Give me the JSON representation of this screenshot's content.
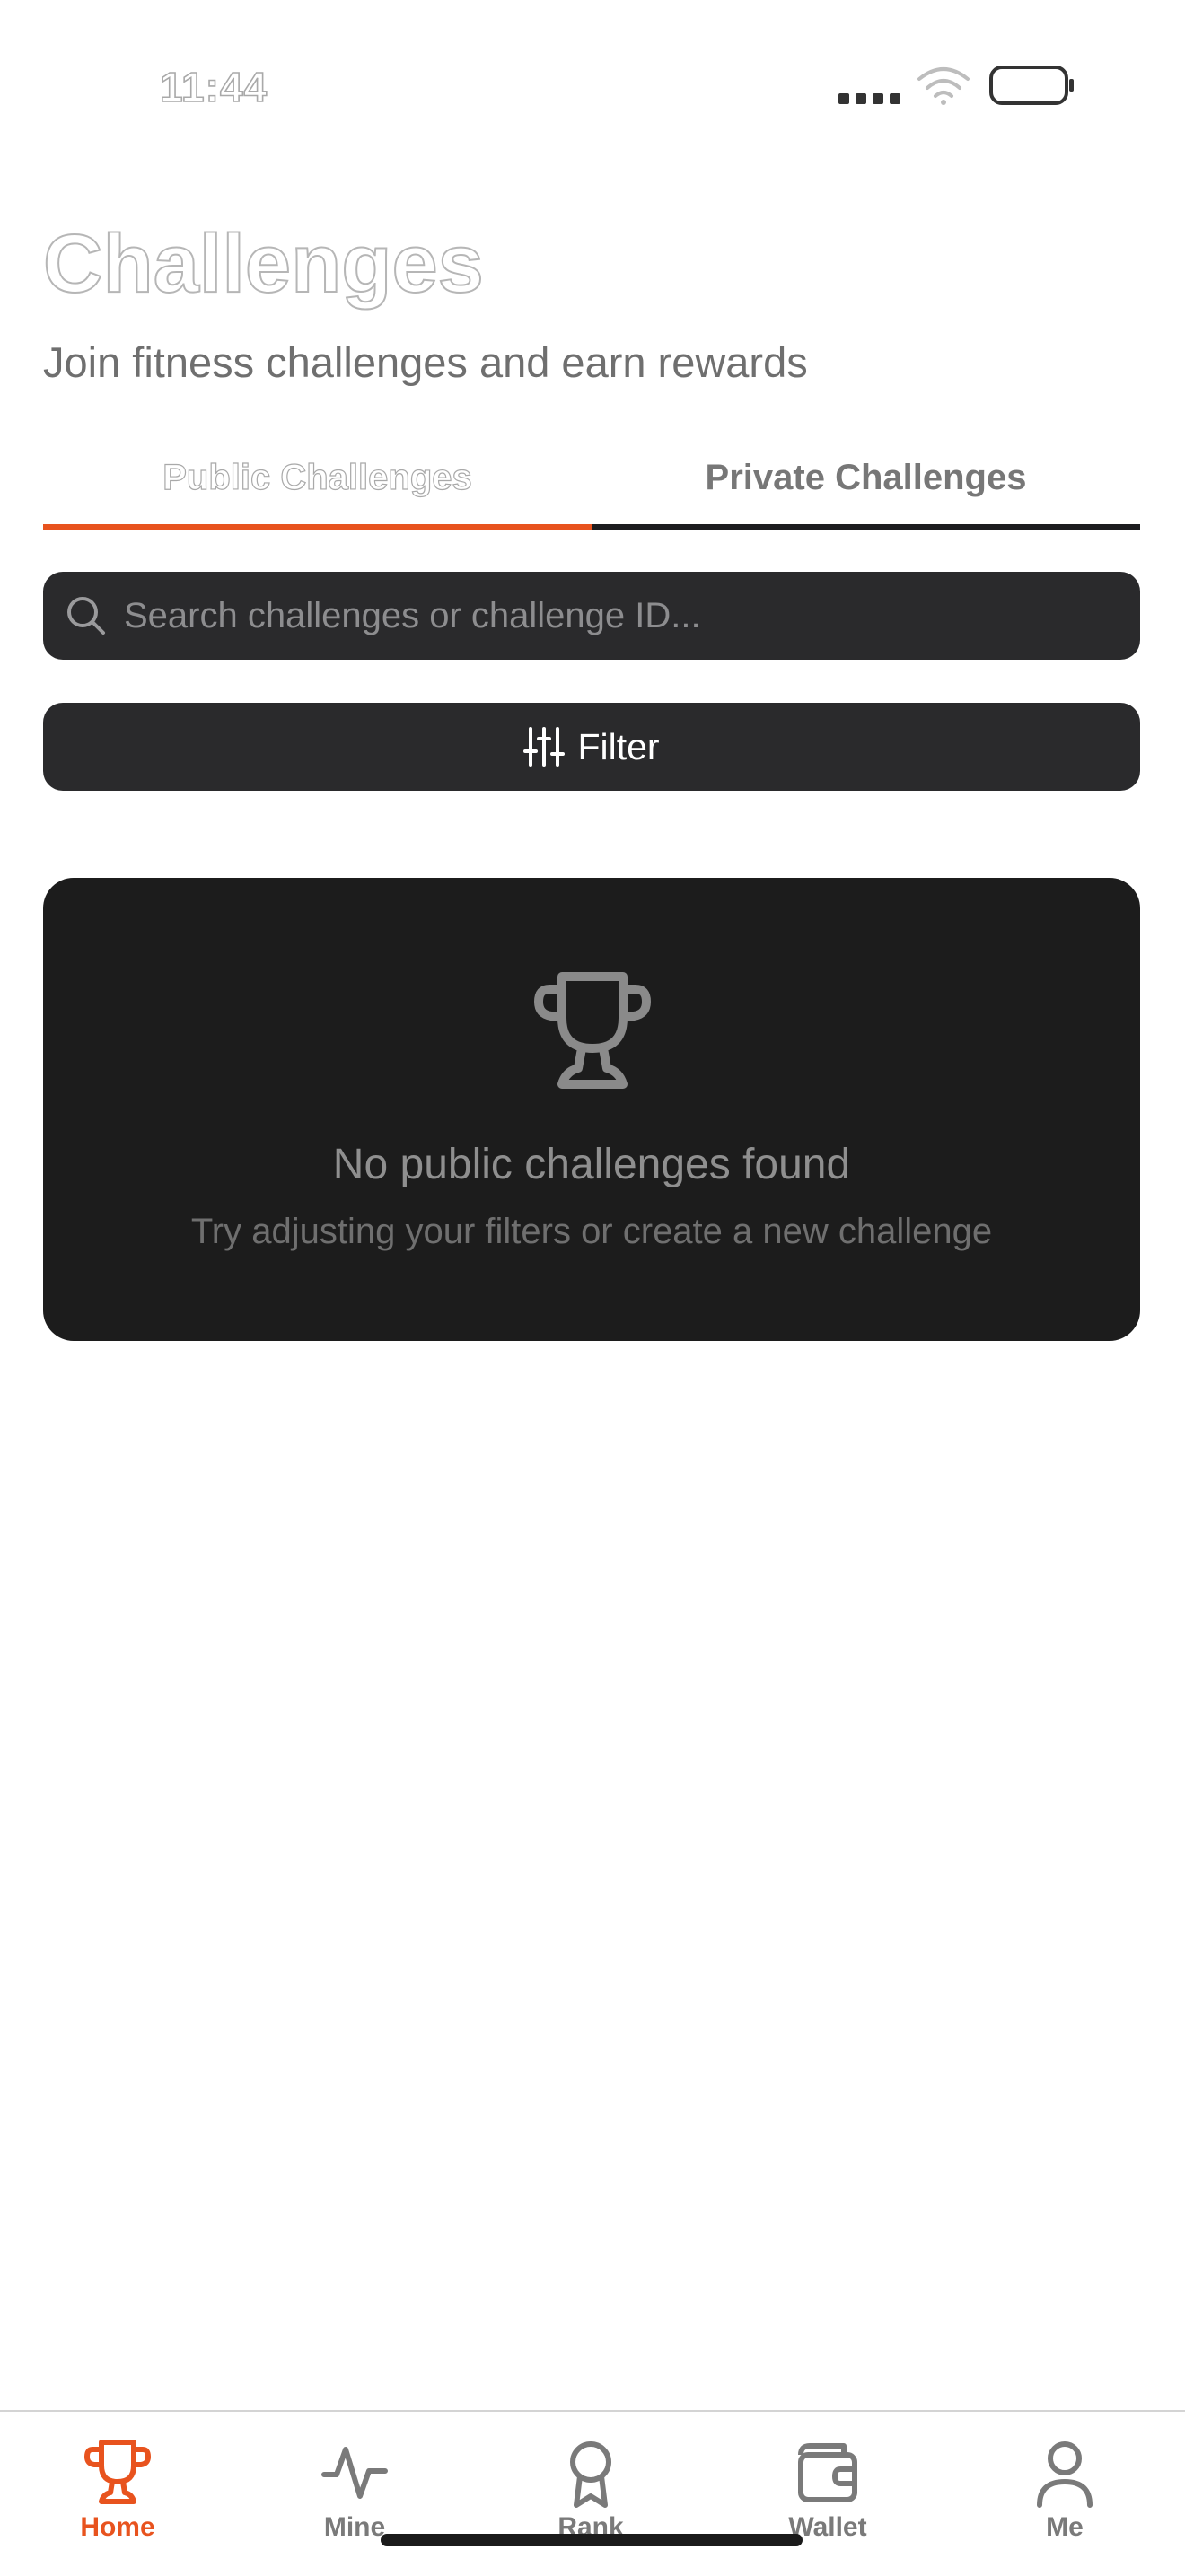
{
  "status_bar": {
    "time": "11:44"
  },
  "header": {
    "title": "Challenges",
    "subtitle": "Join fitness challenges and earn rewards"
  },
  "tabs": [
    {
      "label": "Public Challenges",
      "active": true
    },
    {
      "label": "Private Challenges",
      "active": false
    }
  ],
  "search": {
    "placeholder": "Search challenges or challenge ID...",
    "value": ""
  },
  "filter": {
    "label": "Filter",
    "icon": "sliders-icon"
  },
  "empty_state": {
    "icon": "trophy-icon",
    "title": "No public challenges found",
    "message": "Try adjusting your filters or create a new challenge"
  },
  "bottom_nav": {
    "items": [
      {
        "label": "Home",
        "icon": "trophy-icon",
        "active": true
      },
      {
        "label": "Mine",
        "icon": "activity-icon",
        "active": false
      },
      {
        "label": "Rank",
        "icon": "award-icon",
        "active": false
      },
      {
        "label": "Wallet",
        "icon": "wallet-icon",
        "active": false
      },
      {
        "label": "Me",
        "icon": "user-icon",
        "active": false
      }
    ]
  },
  "colors": {
    "accent": "#e8531e",
    "card_background": "#1c1c1c",
    "input_background": "#2a2a2c",
    "nav_inactive": "#7a7a7a"
  }
}
